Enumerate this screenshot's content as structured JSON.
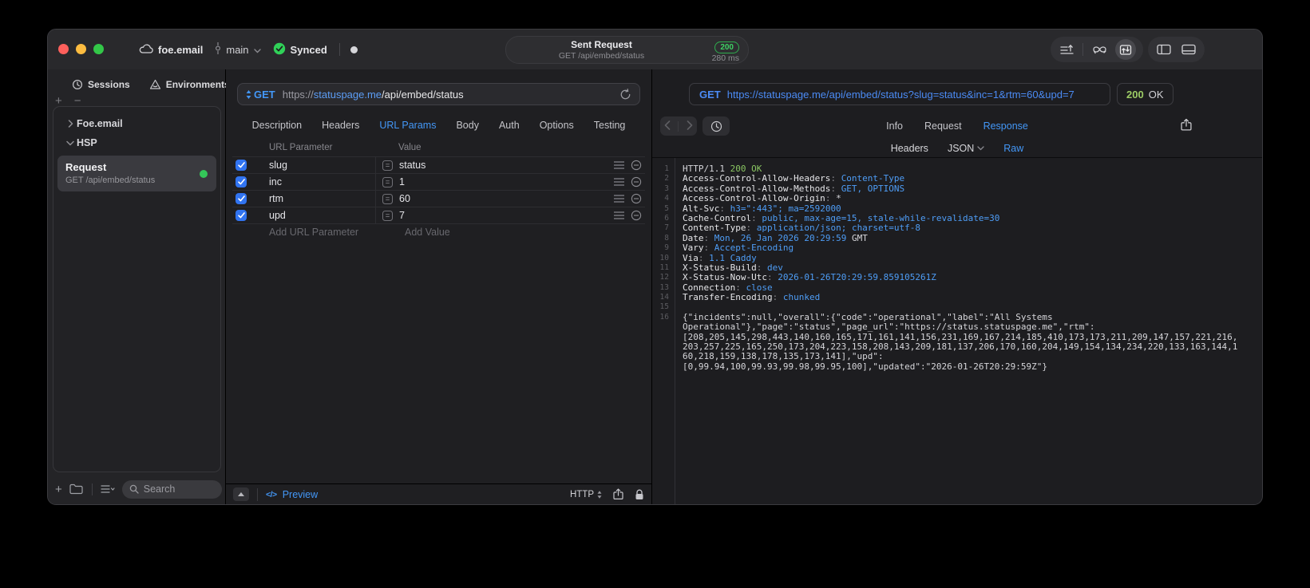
{
  "titlebar": {
    "project": "foe.email",
    "branch": "main",
    "sync_status": "Synced",
    "request_summary": {
      "title": "Sent Request",
      "subtitle": "GET /api/embed/status",
      "status_code": "200",
      "duration": "280 ms"
    }
  },
  "sidebar": {
    "tabs": [
      "Sessions",
      "Environments"
    ],
    "tree": [
      {
        "label": "Foe.email",
        "state": "collapsed"
      },
      {
        "label": "HSP",
        "state": "expanded"
      }
    ],
    "request_item": {
      "title": "Request",
      "subtitle": "GET /api/embed/status"
    },
    "search_placeholder": "Search"
  },
  "request_panel": {
    "method": "GET",
    "url": {
      "scheme": "https://",
      "host": "statuspage.me",
      "path": "/api/embed/status"
    },
    "tabs": [
      "Description",
      "Headers",
      "URL Params",
      "Body",
      "Auth",
      "Options",
      "Testing"
    ],
    "active_tab": "URL Params",
    "params": {
      "columns": [
        "URL Parameter",
        "Value"
      ],
      "rows": [
        {
          "name": "slug",
          "value": "status",
          "enabled": true
        },
        {
          "name": "inc",
          "value": "1",
          "enabled": true
        },
        {
          "name": "rtm",
          "value": "60",
          "enabled": true
        },
        {
          "name": "upd",
          "value": "7",
          "enabled": true
        }
      ],
      "add_name_placeholder": "Add URL Parameter",
      "add_value_placeholder": "Add Value"
    },
    "footer": {
      "preview": "Preview",
      "protocol": "HTTP"
    }
  },
  "response_panel": {
    "request_line": {
      "method": "GET",
      "url": "https://statuspage.me/api/embed/status?slug=status&inc=1&rtm=60&upd=7"
    },
    "status": {
      "code": "200",
      "text": "OK"
    },
    "tabs": [
      "Info",
      "Request",
      "Response"
    ],
    "active_tab": "Response",
    "view_tabs": [
      "Headers",
      "JSON",
      "Raw"
    ],
    "active_view_tab": "Raw",
    "raw_lines": [
      {
        "n": "1",
        "s": [
          [
            "HTTP/1.1 ",
            "p"
          ],
          [
            "200 OK",
            "g"
          ]
        ]
      },
      {
        "n": "2",
        "s": [
          [
            "Access-Control-Allow-Headers",
            "h"
          ],
          [
            ": ",
            "d"
          ],
          [
            "Content-Type",
            "b"
          ]
        ]
      },
      {
        "n": "3",
        "s": [
          [
            "Access-Control-Allow-Methods",
            "h"
          ],
          [
            ": ",
            "d"
          ],
          [
            "GET, OPTIONS",
            "b"
          ]
        ]
      },
      {
        "n": "4",
        "s": [
          [
            "Access-Control-Allow-Origin",
            "h"
          ],
          [
            ": ",
            "d"
          ],
          [
            "*",
            "p"
          ]
        ]
      },
      {
        "n": "5",
        "s": [
          [
            "Alt-Svc",
            "h"
          ],
          [
            ": ",
            "d"
          ],
          [
            "h3=\":443\"; ma=2592000",
            "b"
          ]
        ]
      },
      {
        "n": "6",
        "s": [
          [
            "Cache-Control",
            "h"
          ],
          [
            ": ",
            "d"
          ],
          [
            "public, max-age=15, stale-while-revalidate=30",
            "b"
          ]
        ]
      },
      {
        "n": "7",
        "s": [
          [
            "Content-Type",
            "h"
          ],
          [
            ": ",
            "d"
          ],
          [
            "application/json; charset=utf-8",
            "b"
          ]
        ]
      },
      {
        "n": "8",
        "s": [
          [
            "Date",
            "h"
          ],
          [
            ": ",
            "d"
          ],
          [
            "Mon, 26 Jan 2026 20:29:59",
            "b"
          ],
          [
            " GMT",
            "p"
          ]
        ]
      },
      {
        "n": "9",
        "s": [
          [
            "Vary",
            "h"
          ],
          [
            ": ",
            "d"
          ],
          [
            "Accept-Encoding",
            "b"
          ]
        ]
      },
      {
        "n": "10",
        "s": [
          [
            "Via",
            "h"
          ],
          [
            ": ",
            "d"
          ],
          [
            "1.1 Caddy",
            "b"
          ]
        ]
      },
      {
        "n": "11",
        "s": [
          [
            "X-Status-Build",
            "h"
          ],
          [
            ": ",
            "d"
          ],
          [
            "dev",
            "b"
          ]
        ]
      },
      {
        "n": "12",
        "s": [
          [
            "X-Status-Now-Utc",
            "h"
          ],
          [
            ": ",
            "d"
          ],
          [
            "2026-01-26T20:29:59.859105261Z",
            "b"
          ]
        ]
      },
      {
        "n": "13",
        "s": [
          [
            "Connection",
            "h"
          ],
          [
            ": ",
            "d"
          ],
          [
            "close",
            "b"
          ]
        ]
      },
      {
        "n": "14",
        "s": [
          [
            "Transfer-Encoding",
            "h"
          ],
          [
            ": ",
            "d"
          ],
          [
            "chunked",
            "b"
          ]
        ]
      },
      {
        "n": "15",
        "s": []
      },
      {
        "n": "16",
        "s": [
          [
            "{\"incidents\":null,\"overall\":{\"code\":\"operational\",\"label\":\"All Systems",
            "p"
          ]
        ]
      },
      {
        "n": "",
        "s": [
          [
            "Operational\"},\"page\":\"status\",\"page_url\":\"https://status.statuspage.me\",\"rtm\":",
            "p"
          ]
        ]
      },
      {
        "n": "",
        "s": [
          [
            "[208,205,145,298,443,140,160,165,171,161,141,156,231,169,167,214,185,410,173,173,211,209,147,157,221,216,",
            "p"
          ]
        ]
      },
      {
        "n": "",
        "s": [
          [
            "203,257,225,165,250,173,204,223,158,208,143,209,181,137,206,170,160,204,149,154,134,234,220,133,163,144,1",
            "p"
          ]
        ]
      },
      {
        "n": "",
        "s": [
          [
            "60,218,159,138,178,135,173,141],\"upd\":",
            "p"
          ]
        ]
      },
      {
        "n": "",
        "s": [
          [
            "[0,99.94,100,99.93,99.98,99.95,100],\"updated\":\"2026-01-26T20:29:59Z\"}",
            "p"
          ]
        ]
      }
    ]
  },
  "glyphs": {
    "plus": "+",
    "minus": "−",
    "equals": "=",
    "code_tag": "</>"
  },
  "colors": {
    "accent_blue": "#4397f7",
    "status_green": "#30d158",
    "code_green": "#8ac662",
    "code_blue": "#4e9df6"
  }
}
